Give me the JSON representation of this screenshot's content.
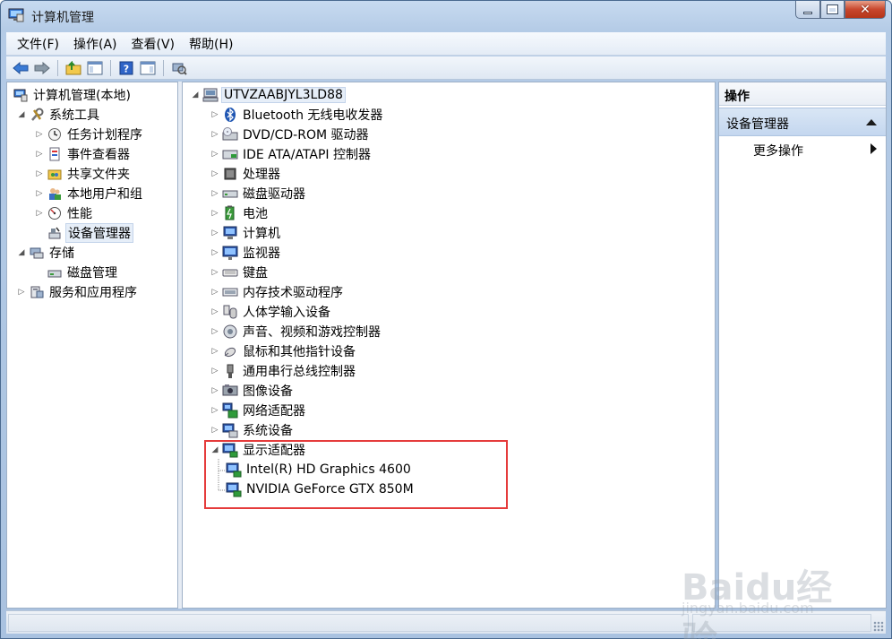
{
  "window": {
    "title": "计算机管理"
  },
  "menubar": {
    "items": [
      "文件(F)",
      "操作(A)",
      "查看(V)",
      "帮助(H)"
    ]
  },
  "left_tree": [
    {
      "label": "计算机管理(本地)",
      "icon": "computer-management-icon"
    },
    {
      "label": "系统工具",
      "icon": "tools-icon"
    },
    {
      "label": "任务计划程序",
      "icon": "clock-icon"
    },
    {
      "label": "事件查看器",
      "icon": "event-viewer-icon"
    },
    {
      "label": "共享文件夹",
      "icon": "shared-folder-icon"
    },
    {
      "label": "本地用户和组",
      "icon": "users-icon"
    },
    {
      "label": "性能",
      "icon": "performance-icon"
    },
    {
      "label": "设备管理器",
      "icon": "device-manager-icon"
    },
    {
      "label": "存储",
      "icon": "storage-icon"
    },
    {
      "label": "磁盘管理",
      "icon": "disk-management-icon"
    },
    {
      "label": "服务和应用程序",
      "icon": "services-icon"
    }
  ],
  "device_tree": {
    "root": "UTVZAABJYL3LD88",
    "categories": [
      {
        "label": "Bluetooth 无线电收发器",
        "icon": "bluetooth-icon"
      },
      {
        "label": "DVD/CD-ROM 驱动器",
        "icon": "dvd-drive-icon"
      },
      {
        "label": "IDE ATA/ATAPI 控制器",
        "icon": "ide-controller-icon"
      },
      {
        "label": "处理器",
        "icon": "processor-icon"
      },
      {
        "label": "磁盘驱动器",
        "icon": "disk-drive-icon"
      },
      {
        "label": "电池",
        "icon": "battery-icon"
      },
      {
        "label": "计算机",
        "icon": "computer-icon"
      },
      {
        "label": "监视器",
        "icon": "monitor-icon"
      },
      {
        "label": "键盘",
        "icon": "keyboard-icon"
      },
      {
        "label": "内存技术驱动程序",
        "icon": "memory-icon"
      },
      {
        "label": "人体学输入设备",
        "icon": "hid-icon"
      },
      {
        "label": "声音、视频和游戏控制器",
        "icon": "sound-icon"
      },
      {
        "label": "鼠标和其他指针设备",
        "icon": "mouse-icon"
      },
      {
        "label": "通用串行总线控制器",
        "icon": "usb-icon"
      },
      {
        "label": "图像设备",
        "icon": "camera-icon"
      },
      {
        "label": "网络适配器",
        "icon": "network-icon"
      },
      {
        "label": "系统设备",
        "icon": "system-device-icon"
      },
      {
        "label": "显示适配器",
        "icon": "display-adapter-icon"
      }
    ],
    "display_adapters": [
      "Intel(R) HD Graphics 4600",
      "NVIDIA GeForce GTX 850M"
    ]
  },
  "actions": {
    "header": "操作",
    "section": "设备管理器",
    "more": "更多操作"
  },
  "watermark": {
    "main": "Baidu经验",
    "sub": "jingyan.baidu.com"
  },
  "colors": {
    "highlight": "#e53b3b",
    "selection": "#e6eef8"
  }
}
